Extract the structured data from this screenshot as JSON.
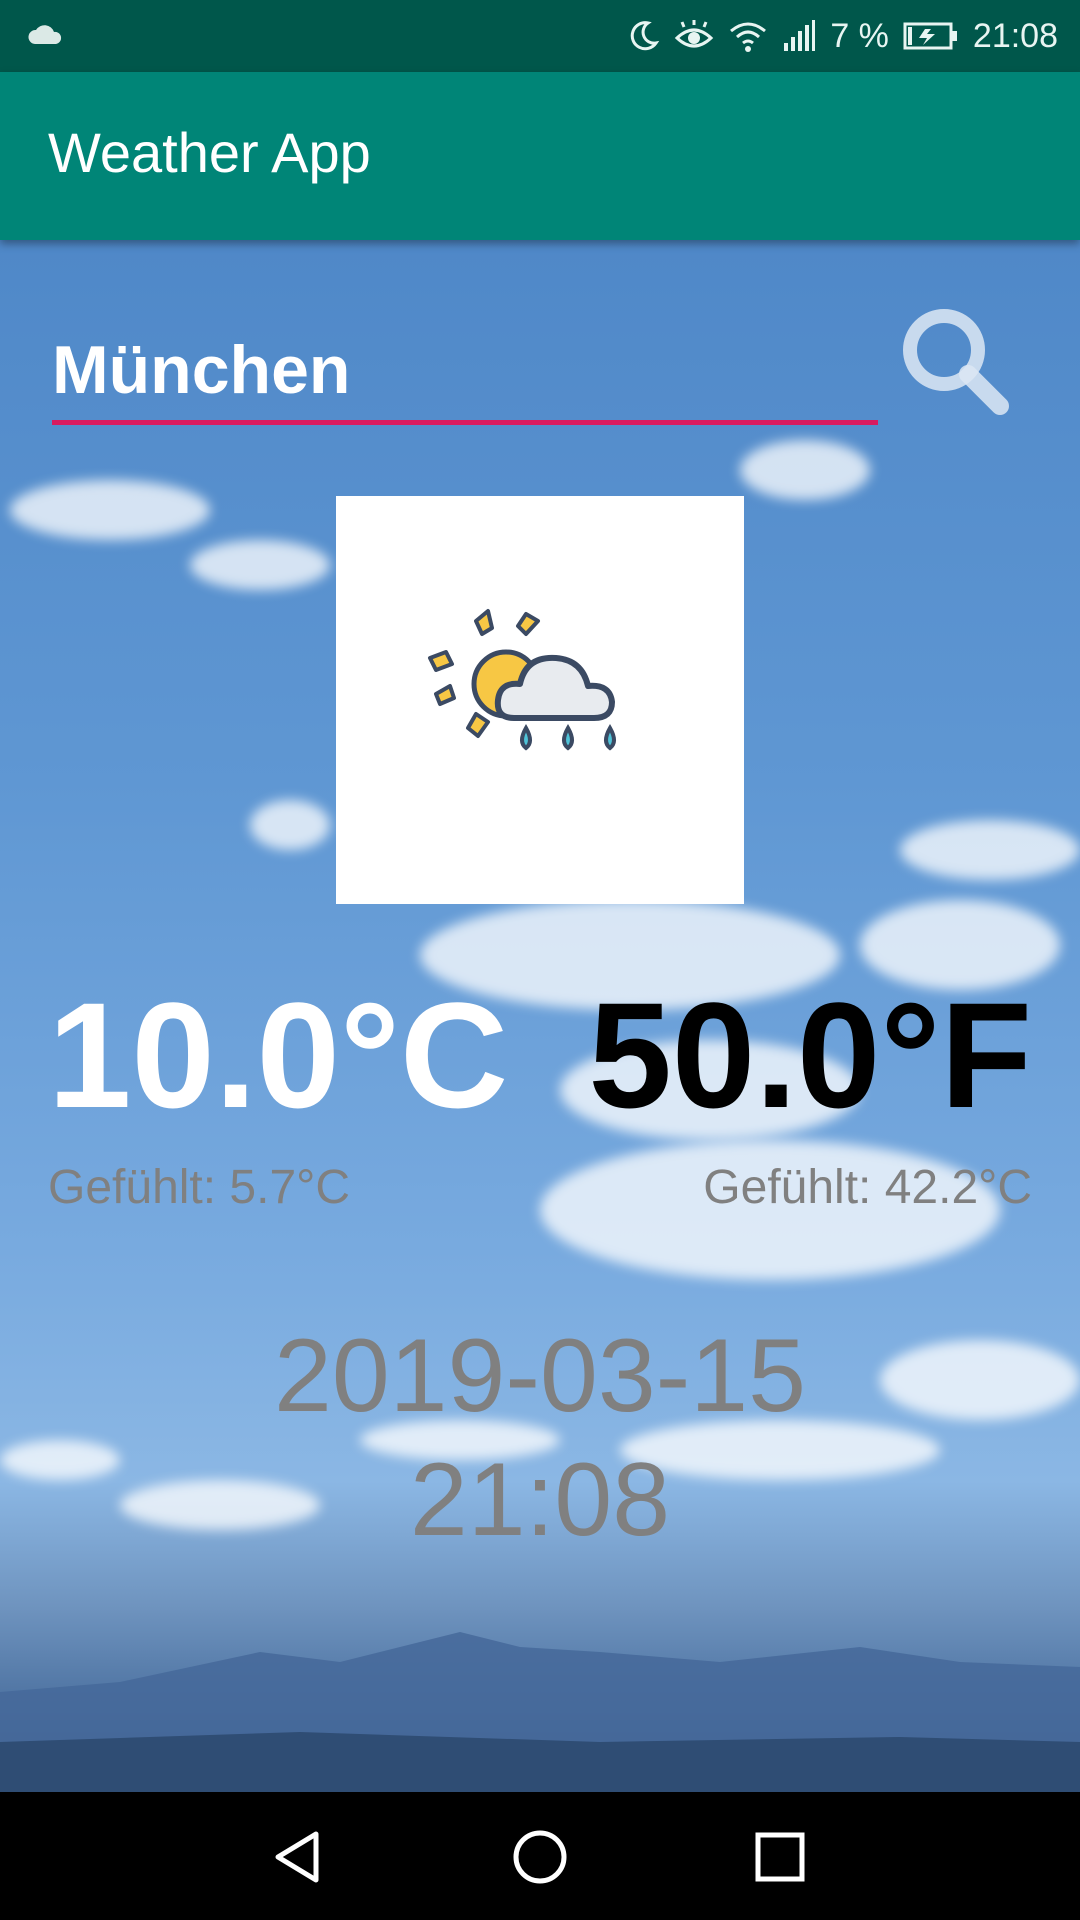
{
  "status_bar": {
    "battery_text": "7 %",
    "time": "21:08",
    "icons": [
      "cloud-notification-icon",
      "moon-icon",
      "eye-icon",
      "wifi-icon",
      "signal-icon",
      "battery-charging-icon"
    ]
  },
  "app_bar": {
    "title": "Weather App"
  },
  "search": {
    "city_value": "München",
    "icon": "search-icon"
  },
  "weather": {
    "icon": "sun-cloud-rain-icon",
    "temp_c": "10.0°C",
    "temp_f": "50.0°F",
    "feels_c": "Gefühlt: 5.7°C",
    "feels_f": "Gefühlt: 42.2°C",
    "date": "2019-03-15",
    "time": "21:08"
  },
  "colors": {
    "status_bar": "#00574b",
    "app_bar": "#008577",
    "accent_underline": "#d81b60",
    "secondary_text": "#808080"
  },
  "nav_bar": {
    "icons": [
      "back-icon",
      "home-icon",
      "recents-icon"
    ]
  }
}
